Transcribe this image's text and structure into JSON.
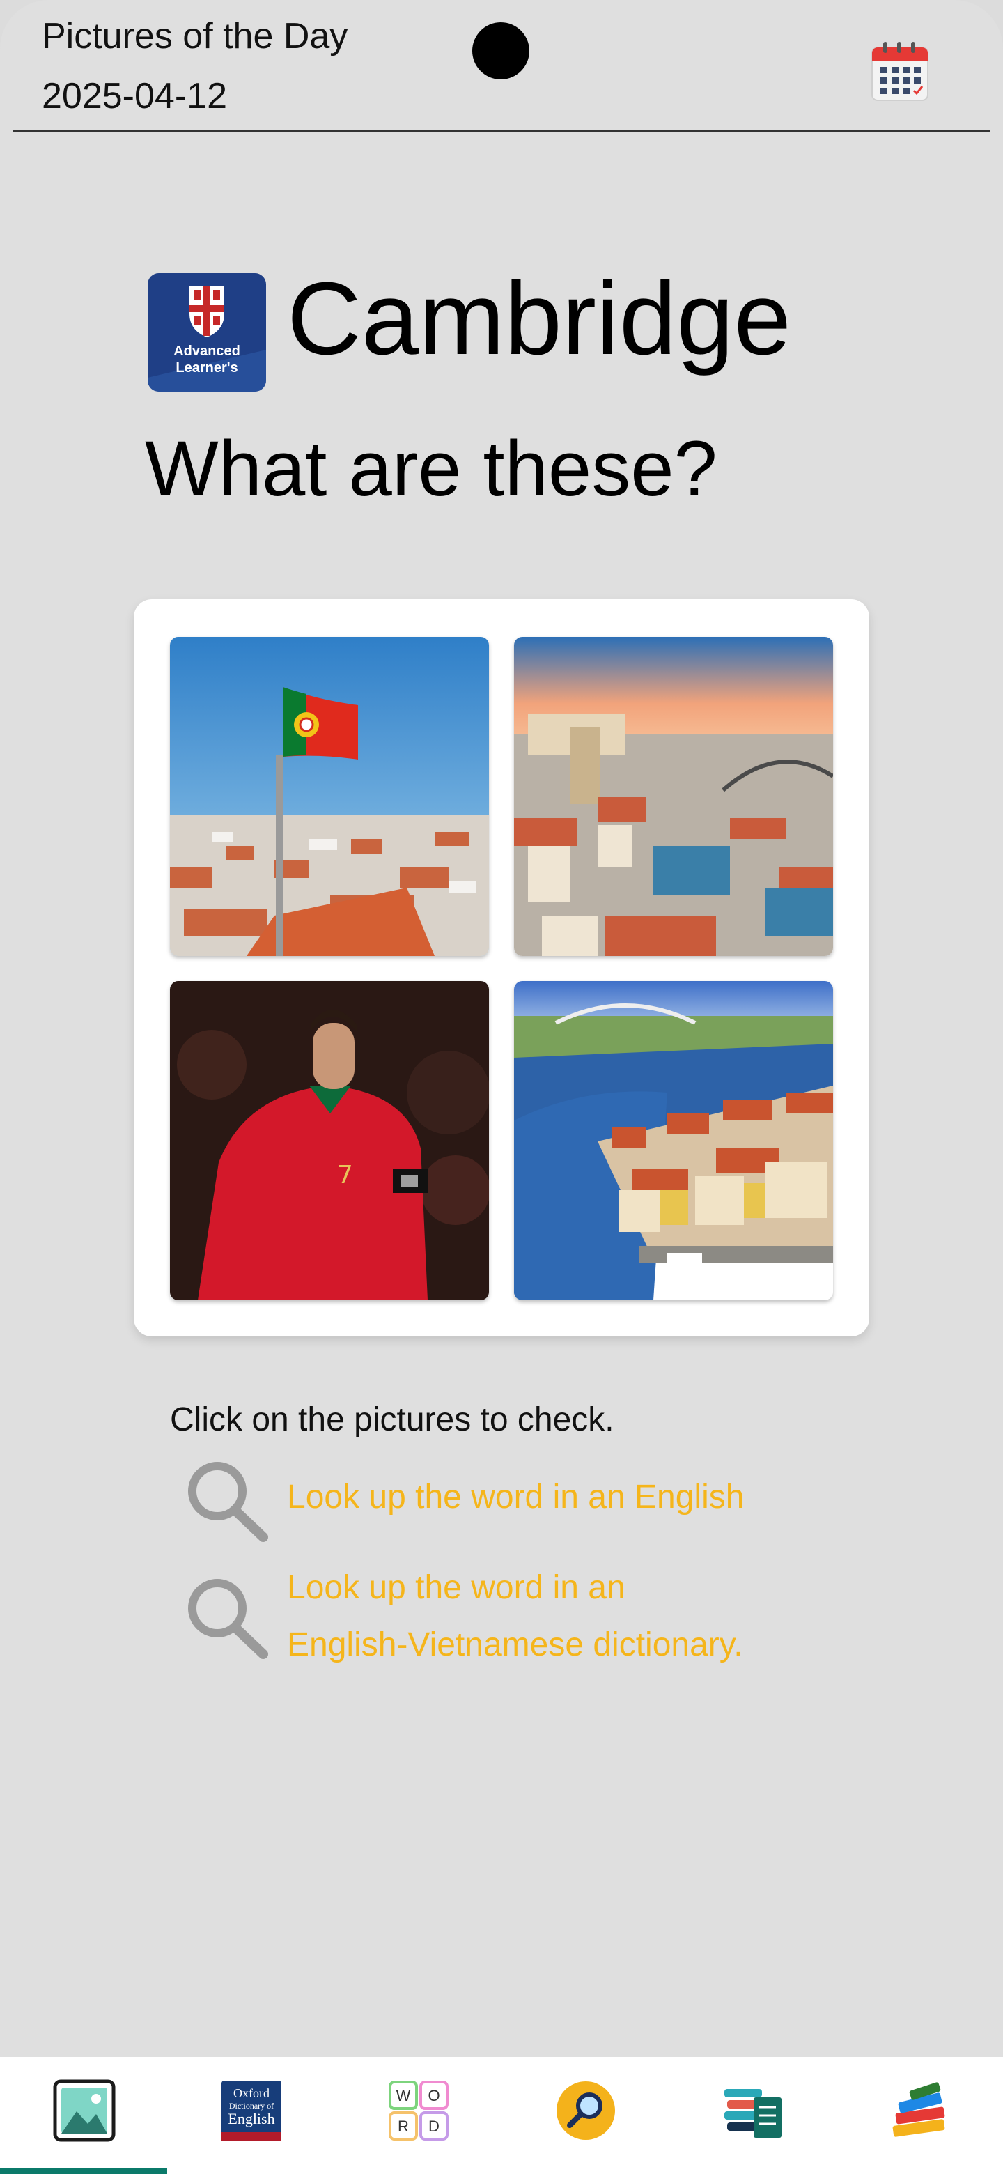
{
  "header": {
    "title": "Pictures of the Day",
    "date": "2025-04-12",
    "calendar_icon": "calendar-icon"
  },
  "brand": {
    "logo_text_line1": "Advanced",
    "logo_text_line2": "Learner's",
    "name": "Cambridge"
  },
  "question": "What are these?",
  "pictures": [
    {
      "icon": "flag-over-city-picture"
    },
    {
      "icon": "city-bridge-picture"
    },
    {
      "icon": "footballer-picture"
    },
    {
      "icon": "riverside-city-picture"
    }
  ],
  "instructions": {
    "click_text": "Click on the pictures to check.",
    "lookup_english": "Look up the word in an English",
    "lookup_vietnamese_line1": "Look up the word in an",
    "lookup_vietnamese_line2": "English-Vietnamese dictionary."
  },
  "bottom_nav": {
    "items": [
      {
        "icon": "pictures-icon",
        "active": true
      },
      {
        "icon": "oxford-dictionary-icon"
      },
      {
        "icon": "word-game-icon"
      },
      {
        "icon": "search-icon"
      },
      {
        "icon": "word-list-icon"
      },
      {
        "icon": "books-icon"
      }
    ],
    "oxford_line1": "Oxford",
    "oxford_line2": "Dictionary of",
    "oxford_line3": "English",
    "word_letters": [
      "W",
      "O",
      "R",
      "D"
    ]
  },
  "colors": {
    "accent": "#0b7a6a",
    "lookup_text": "#f5b51b",
    "background": "#dfdfdf"
  }
}
